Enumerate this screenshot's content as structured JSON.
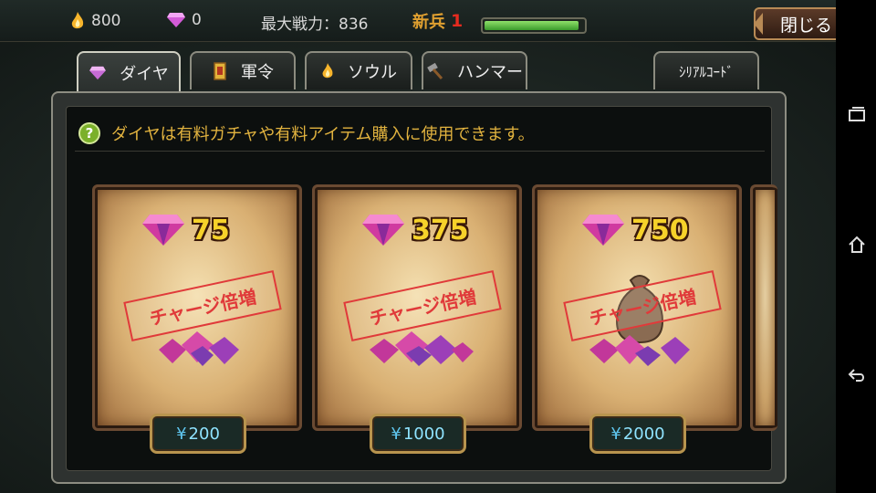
{
  "header": {
    "soul_count": "800",
    "diamond_count": "0",
    "power_label": "最大戦力：836",
    "rank_label": "新兵",
    "rank_level": "1",
    "exp_progress": 0.95,
    "close_label": "閉じる"
  },
  "tabs": [
    {
      "label": "ダイヤ",
      "icon": "diamond-icon",
      "active": true
    },
    {
      "label": "軍令",
      "icon": "scroll-icon",
      "active": false
    },
    {
      "label": "ソウル",
      "icon": "flame-icon",
      "active": false
    },
    {
      "label": "ハンマー",
      "icon": "hammer-icon",
      "active": false
    },
    {
      "label": "ｼﾘｱﾙｺｰﾄﾞ",
      "active": false
    }
  ],
  "info": {
    "icon": "?",
    "text": "ダイヤは有料ガチャや有料アイテム購入に使用できます。"
  },
  "products": [
    {
      "amount": "75",
      "stamp": "チャージ倍増",
      "price": "200",
      "currency": "¥"
    },
    {
      "amount": "375",
      "stamp": "チャージ倍増",
      "price": "1000",
      "currency": "¥"
    },
    {
      "amount": "750",
      "stamp": "チャージ倍増",
      "price": "2000",
      "currency": "¥"
    }
  ],
  "colors": {
    "gold_text": "#e2b33f",
    "amount_text": "#f6d22a",
    "stamp_red": "#e03a3a",
    "price_text": "#8fe3ff",
    "exp_green": "#3b9a2c"
  }
}
